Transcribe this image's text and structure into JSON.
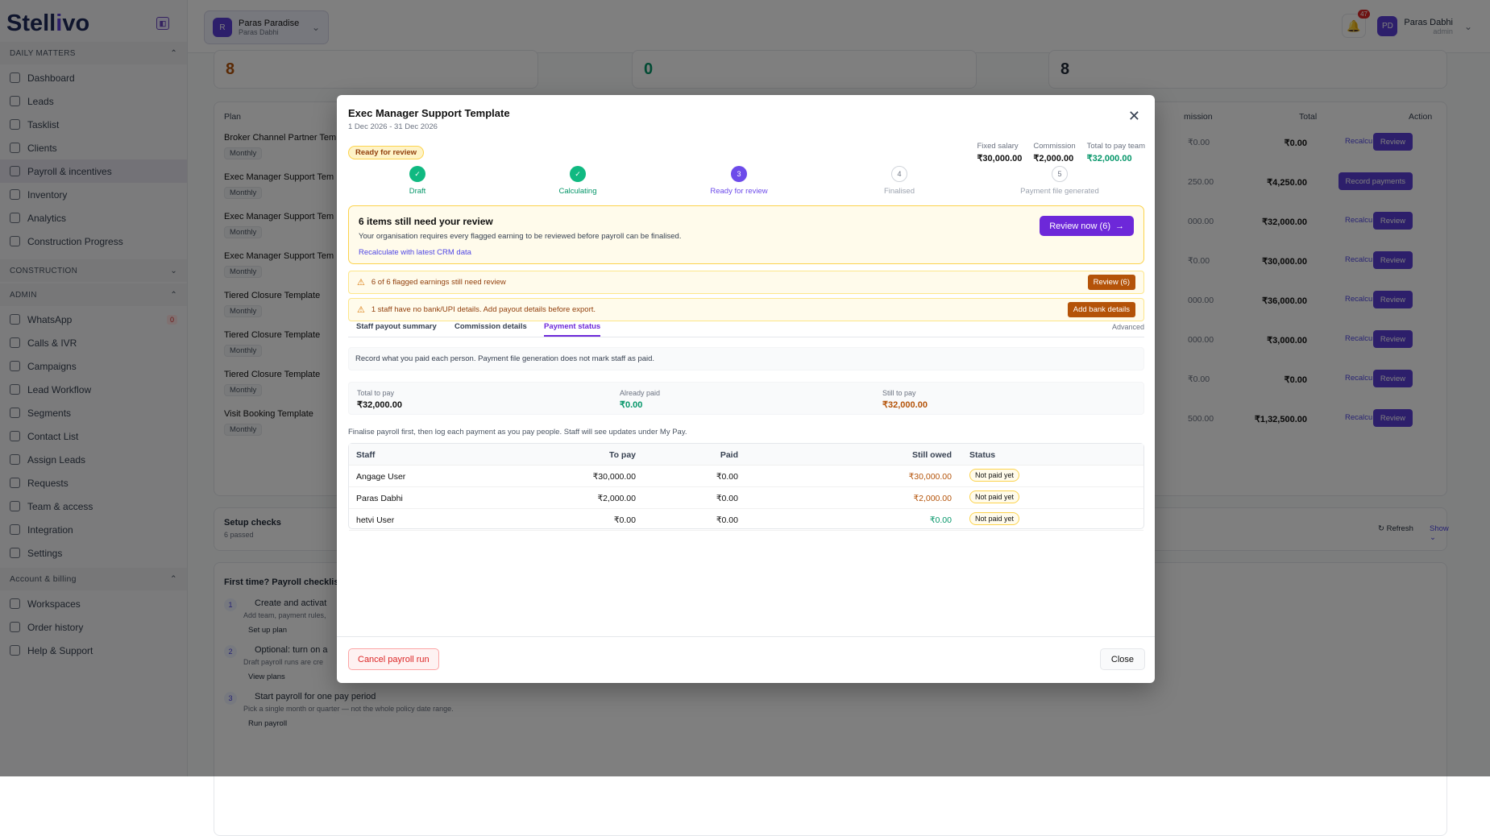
{
  "sidebar": {
    "logo_a": "Stell",
    "logo_o": "i",
    "logo_b": "vo",
    "sections": [
      {
        "label": "DAILY MATTERS"
      },
      {
        "label": "CONSTRUCTION"
      },
      {
        "label": "ADMIN"
      },
      {
        "label": "Account & billing"
      }
    ],
    "daily": [
      "Dashboard",
      "Leads",
      "Tasklist",
      "Clients",
      "Payroll & incentives",
      "Inventory",
      "Analytics",
      "Construction Progress"
    ],
    "admin": [
      "WhatsApp",
      "Calls & IVR",
      "Campaigns",
      "Lead Workflow",
      "Segments",
      "Contact List",
      "Assign Leads",
      "Requests",
      "Team & access",
      "Integration",
      "Settings"
    ],
    "whatsapp_count": "0",
    "billing": [
      "Workspaces",
      "Order history",
      "Help & Support"
    ]
  },
  "topbar": {
    "ws_initial": "R",
    "ws_name": "Paras Paradise",
    "ws_owner": "Paras Dabhi",
    "notif_count": "47",
    "user_initials": "PD",
    "user_name": "Paras Dabhi",
    "user_role": "admin"
  },
  "background": {
    "stats": [
      "8",
      "0",
      "8"
    ],
    "plan_header": "Plan",
    "commission_header": "mission",
    "total_header": "Total",
    "action_header": "Action",
    "plans": [
      {
        "name": "Broker Channel Partner Tem",
        "period": "Monthly",
        "comm": "₹0.00",
        "total": "₹0.00",
        "recalc": "Recalculate",
        "btn": "Review"
      },
      {
        "name": "Exec Manager Support Tem",
        "period": "Monthly",
        "comm": "250.00",
        "total": "₹4,250.00",
        "recalc": "",
        "btn": "Record payments"
      },
      {
        "name": "Exec Manager Support Tem",
        "period": "Monthly",
        "comm": "000.00",
        "total": "₹32,000.00",
        "recalc": "Recalculate",
        "btn": "Review"
      },
      {
        "name": "Exec Manager Support Tem",
        "period": "Monthly",
        "comm": "₹0.00",
        "total": "₹30,000.00",
        "recalc": "Recalculate",
        "btn": "Review"
      },
      {
        "name": "Tiered Closure Template",
        "period": "Monthly",
        "comm": "000.00",
        "total": "₹36,000.00",
        "recalc": "Recalculate",
        "btn": "Review"
      },
      {
        "name": "Tiered Closure Template",
        "period": "Monthly",
        "comm": "000.00",
        "total": "₹3,000.00",
        "recalc": "Recalculate",
        "btn": "Review"
      },
      {
        "name": "Tiered Closure Template",
        "period": "Monthly",
        "comm": "₹0.00",
        "total": "₹0.00",
        "recalc": "Recalculate",
        "btn": "Review"
      },
      {
        "name": "Visit Booking Template",
        "period": "Monthly",
        "comm": "500.00",
        "total": "₹1,32,500.00",
        "recalc": "Recalculate",
        "btn": "Review"
      }
    ],
    "setup_title": "Setup checks",
    "setup_sub": "6 passed",
    "refresh": "Refresh",
    "show": "Show",
    "checklist_title": "First time? Payroll checklist",
    "checklist": [
      {
        "n": "1",
        "t": "Create and activat",
        "s": "Add team, payment rules,",
        "a": "Set up plan"
      },
      {
        "n": "2",
        "t": "Optional: turn on a",
        "s": "Draft payroll runs are cre",
        "a": "View plans"
      },
      {
        "n": "3",
        "t": "Start payroll for one pay period",
        "s": "Pick a single month or quarter — not the whole policy date range.",
        "a": "Run payroll"
      }
    ]
  },
  "modal": {
    "title": "Exec Manager Support Template",
    "dates": "1 Dec 2026 - 31 Dec 2026",
    "status": "Ready for review",
    "fixed_label": "Fixed salary",
    "fixed": "₹30,000.00",
    "comm_label": "Commission",
    "comm": "₹2,000.00",
    "total_label": "Total to pay team",
    "total": "₹32,000.00",
    "steps": [
      {
        "n": "✓",
        "label": "Draft"
      },
      {
        "n": "✓",
        "label": "Calculating"
      },
      {
        "n": "3",
        "label": "Ready for review"
      },
      {
        "n": "4",
        "label": "Finalised"
      },
      {
        "n": "5",
        "label": "Payment file generated"
      }
    ],
    "review_title": "6 items still need your review",
    "review_sub": "Your organisation requires every flagged earning to be reviewed before payroll can be finalised.",
    "review_link": "Recalculate with latest CRM data",
    "review_btn": "Review now (6)",
    "warn1": "6 of 6 flagged earnings still need review",
    "warn1_btn": "Review (6)",
    "warn2": "1 staff have no bank/UPI details. Add payout details before export.",
    "warn2_btn": "Add bank details",
    "tabs": [
      "Staff payout summary",
      "Commission details",
      "Payment status"
    ],
    "advanced": "Advanced",
    "info": "Record what you paid each person. Payment file generation does not mark staff as paid.",
    "tot_label": "Total to pay",
    "tot": "₹32,000.00",
    "paid_label": "Already paid",
    "paid": "₹0.00",
    "still_label": "Still to pay",
    "still": "₹32,000.00",
    "hint": "Finalise payroll first, then log each payment as you pay people. Staff will see updates under My Pay.",
    "cols": [
      "Staff",
      "To pay",
      "Paid",
      "Still owed",
      "Status"
    ],
    "rows": [
      {
        "staff": "Angage User",
        "topay": "₹30,000.00",
        "paid": "₹0.00",
        "owed": "₹30,000.00",
        "status": "Not paid yet"
      },
      {
        "staff": "Paras Dabhi",
        "topay": "₹2,000.00",
        "paid": "₹0.00",
        "owed": "₹2,000.00",
        "status": "Not paid yet"
      },
      {
        "staff": "hetvi User",
        "topay": "₹0.00",
        "paid": "₹0.00",
        "owed": "₹0.00",
        "status": "Not paid yet"
      }
    ],
    "cancel": "Cancel payroll run",
    "close": "Close"
  }
}
